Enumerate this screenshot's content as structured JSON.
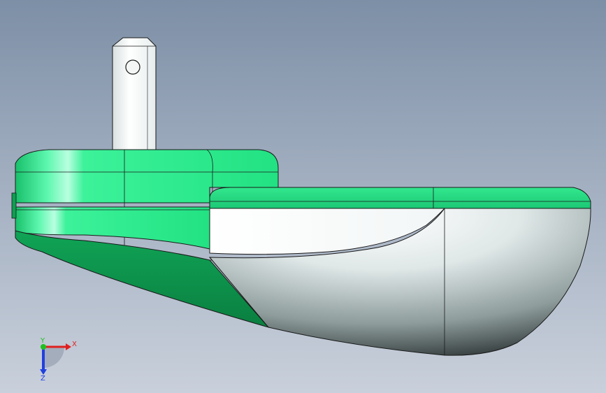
{
  "viewport": {
    "background_top": "#7d8fa6",
    "background_bottom": "#c9d0db"
  },
  "model": {
    "colors": {
      "green_light": "#2ef28c",
      "green_mid": "#1fd47a",
      "green_dark": "#0f9e52",
      "green_shadow": "#0a7a3e",
      "metal_light": "#ffffff",
      "metal_mid": "#c6d2d2",
      "metal_dark": "#2b3434",
      "edge": "#1a1a1a"
    }
  },
  "triad": {
    "x_label": "X",
    "y_label": "Y",
    "z_label": "Z",
    "x_color": "#e02020",
    "y_color": "#20c020",
    "z_color": "#2040e0"
  }
}
